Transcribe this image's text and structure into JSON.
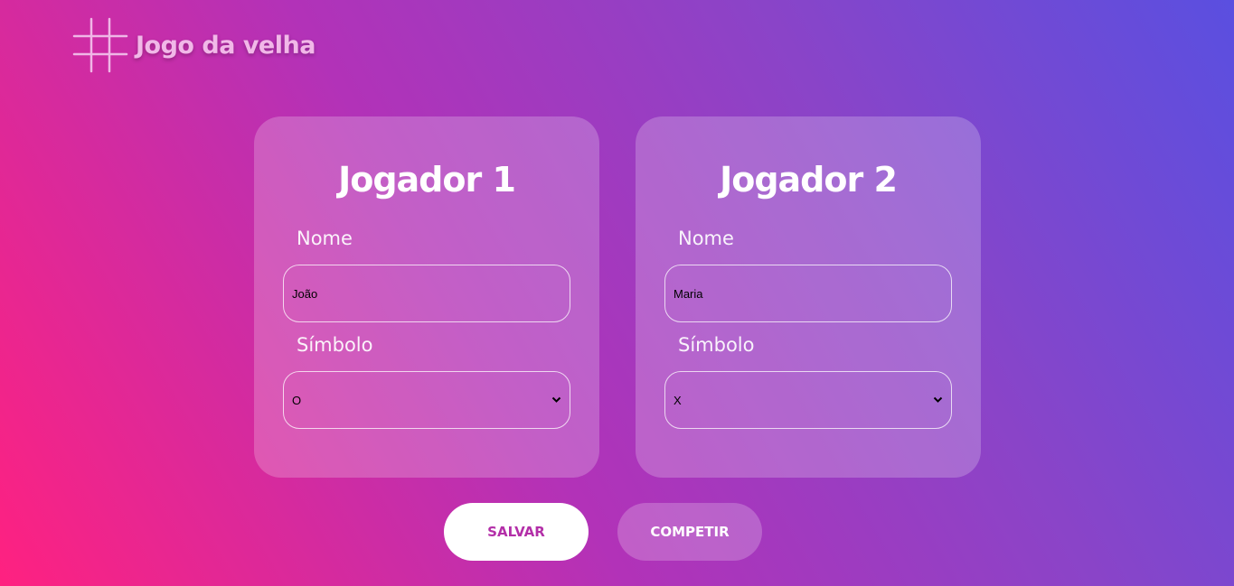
{
  "header": {
    "title": "Jogo da velha",
    "logo_icon": "tic-tac-toe-grid-icon"
  },
  "players": [
    {
      "title": "Jogador 1",
      "name_label": "Nome",
      "name_value": "João",
      "symbol_label": "Símbolo",
      "symbol_value": "O"
    },
    {
      "title": "Jogador 2",
      "name_label": "Nome",
      "name_value": "Maria",
      "symbol_label": "Símbolo",
      "symbol_value": "X"
    }
  ],
  "actions": {
    "save_label": "SALVAR",
    "compete_label": "COMPETIR"
  },
  "colors": {
    "gradient_start": "#ff2180",
    "gradient_end": "#5a4fe0",
    "save_text": "#b32fa8"
  }
}
